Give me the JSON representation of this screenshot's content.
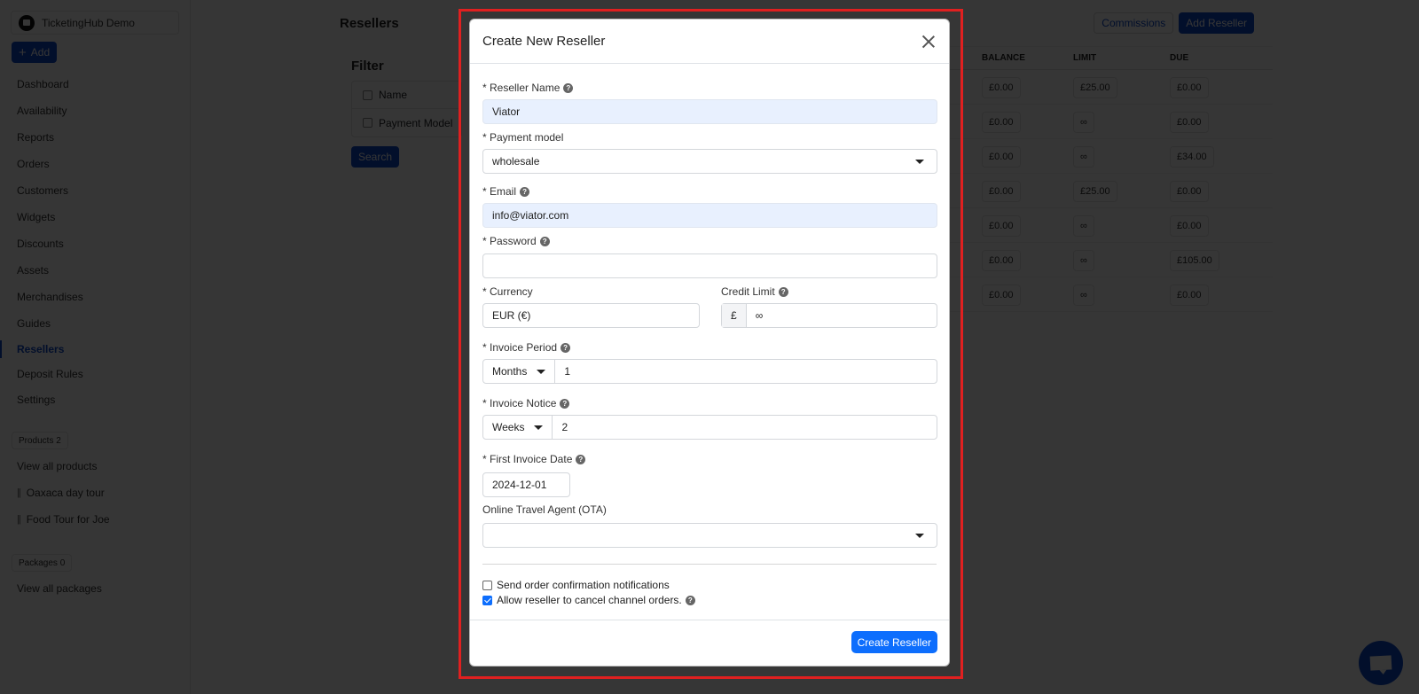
{
  "sidebar": {
    "org_name": "TicketingHub Demo",
    "add_label": "Add",
    "nav": [
      {
        "label": "Dashboard"
      },
      {
        "label": "Availability"
      },
      {
        "label": "Reports"
      },
      {
        "label": "Orders"
      },
      {
        "label": "Customers"
      },
      {
        "label": "Widgets"
      },
      {
        "label": "Discounts"
      },
      {
        "label": "Assets"
      },
      {
        "label": "Merchandises"
      },
      {
        "label": "Guides"
      },
      {
        "label": "Resellers",
        "active": true
      },
      {
        "label": "Deposit Rules"
      },
      {
        "label": "Settings"
      }
    ],
    "products_badge": "Products 2",
    "products": [
      "View all products",
      "Oaxaca day tour",
      "Food Tour for Joe"
    ],
    "packages_badge": "Packages 0",
    "packages": [
      "View all packages"
    ]
  },
  "main": {
    "title": "Resellers",
    "commissions_label": "Commissions",
    "add_reseller_label": "Add Reseller",
    "filter": {
      "title": "Filter",
      "options": [
        "Name",
        "Payment Model"
      ],
      "search_label": "Search"
    },
    "table": {
      "columns": [
        "BALANCE",
        "LIMIT",
        "DUE"
      ],
      "rows": [
        {
          "balance": "£0.00",
          "limit": "£25.00",
          "due": "£0.00"
        },
        {
          "balance": "£0.00",
          "limit": "∞",
          "due": "£0.00"
        },
        {
          "balance": "£0.00",
          "limit": "∞",
          "due": "£34.00"
        },
        {
          "balance": "£0.00",
          "limit": "£25.00",
          "due": "£0.00"
        },
        {
          "balance": "£0.00",
          "limit": "∞",
          "due": "£0.00"
        },
        {
          "balance": "£0.00",
          "limit": "∞",
          "due": "£105.00"
        },
        {
          "balance": "£0.00",
          "limit": "∞",
          "due": "£0.00"
        }
      ]
    }
  },
  "modal": {
    "title": "Create New Reseller",
    "fields": {
      "reseller_name": {
        "label": "* Reseller Name",
        "value": "Viator"
      },
      "payment_model": {
        "label": "* Payment model",
        "value": "wholesale"
      },
      "email": {
        "label": "* Email",
        "value": "info@viator.com"
      },
      "password": {
        "label": "* Password",
        "value": ""
      },
      "currency": {
        "label": "* Currency",
        "value": "EUR (€)"
      },
      "credit_limit": {
        "label": "Credit Limit",
        "prefix": "£",
        "value": "∞"
      },
      "invoice_period": {
        "label": "* Invoice Period",
        "unit": "Months",
        "value": "1"
      },
      "invoice_notice": {
        "label": "* Invoice Notice",
        "unit": "Weeks",
        "value": "2"
      },
      "first_invoice_date": {
        "label": "* First Invoice Date",
        "value": "2024-12-01"
      },
      "ota": {
        "label": "Online Travel Agent (OTA)",
        "value": ""
      }
    },
    "checkboxes": {
      "send_notifications": {
        "label": "Send order confirmation notifications",
        "checked": false
      },
      "allow_cancel": {
        "label": "Allow reseller to cancel channel orders.",
        "checked": true
      }
    },
    "submit_label": "Create Reseller"
  },
  "help_glyph": "?",
  "colors": {
    "brand": "#0d47c9",
    "primary_button": "#0d6efd",
    "highlight_frame": "#e02020",
    "autofill_bg": "#e8f0fe"
  }
}
